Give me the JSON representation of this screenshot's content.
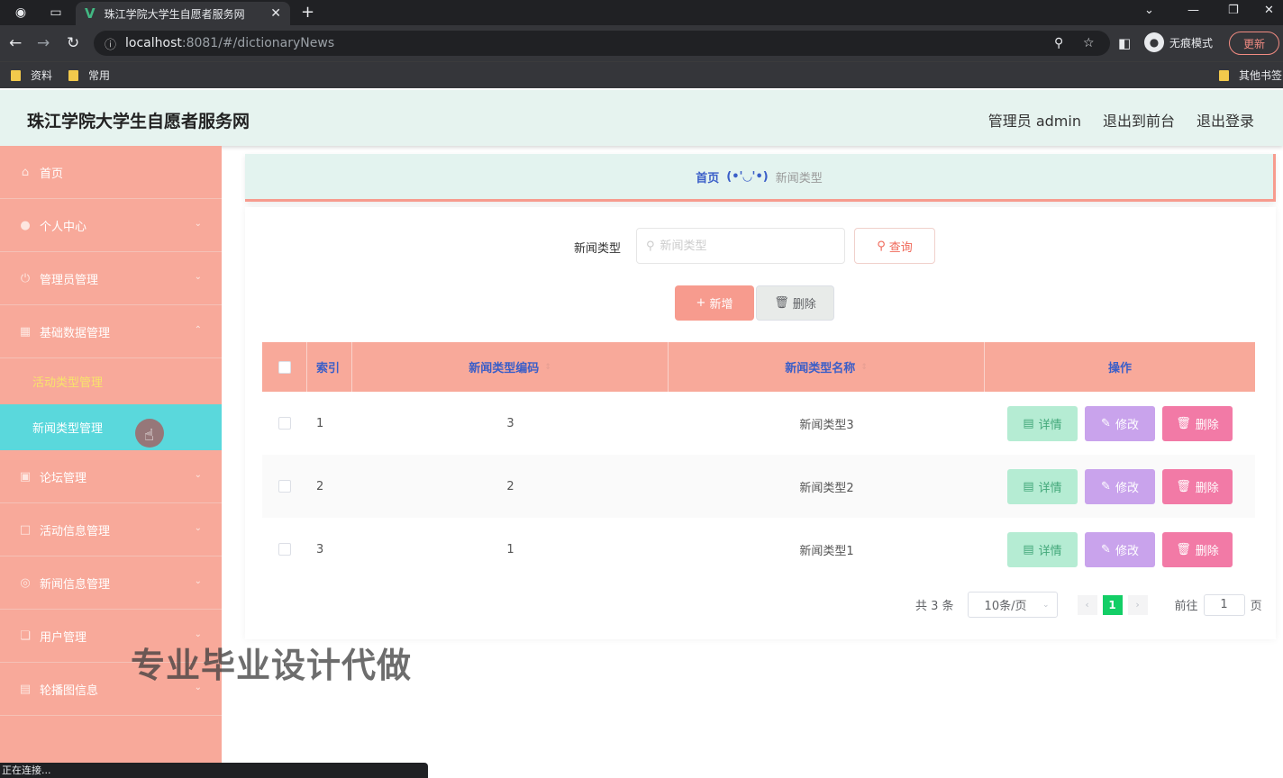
{
  "browser": {
    "tab_title": "珠江学院大学生自愿者服务网",
    "url_host": "localhost",
    "url_path": ":8081/#/dictionaryNews",
    "incognito_label": "无痕模式",
    "update_label": "更新",
    "bookmarks": [
      "资料",
      "常用"
    ],
    "other_bookmarks": "其他书签",
    "status_text": "正在连接..."
  },
  "header": {
    "title": "珠江学院大学生自愿者服务网",
    "user": "管理员 admin",
    "to_front": "退出到前台",
    "logout": "退出登录"
  },
  "sidebar": {
    "items": [
      {
        "label": "首页",
        "icon": "home-icon"
      },
      {
        "label": "个人中心",
        "icon": "user-icon"
      },
      {
        "label": "管理员管理",
        "icon": "power-icon"
      },
      {
        "label": "基础数据管理",
        "icon": "grid-icon",
        "expanded": true
      },
      {
        "label": "论坛管理",
        "icon": "chat-icon"
      },
      {
        "label": "活动信息管理",
        "icon": "message-icon"
      },
      {
        "label": "新闻信息管理",
        "icon": "globe-icon"
      },
      {
        "label": "用户管理",
        "icon": "copy-icon"
      },
      {
        "label": "轮播图信息",
        "icon": "picture-icon"
      }
    ],
    "subitems": [
      "活动类型管理",
      "新闻类型管理"
    ]
  },
  "breadcrumb": {
    "home": "首页",
    "sep": "(•'◡'•)",
    "current": "新闻类型"
  },
  "search": {
    "label": "新闻类型",
    "placeholder": "新闻类型",
    "button": "查询"
  },
  "actions": {
    "add": "新增",
    "delete": "删除"
  },
  "table": {
    "headers": [
      "索引",
      "新闻类型编码",
      "新闻类型名称",
      "操作"
    ],
    "rows": [
      {
        "index": "1",
        "code": "3",
        "name": "新闻类型3"
      },
      {
        "index": "2",
        "code": "2",
        "name": "新闻类型2"
      },
      {
        "index": "3",
        "code": "1",
        "name": "新闻类型1"
      }
    ],
    "row_actions": {
      "detail": "详情",
      "edit": "修改",
      "delete": "删除"
    }
  },
  "pagination": {
    "total": "共 3 条",
    "page_size": "10条/页",
    "current_page": "1",
    "goto_prefix": "前往",
    "goto_value": "1",
    "goto_suffix": "页"
  },
  "watermark": "专业毕业设计代做",
  "colors": {
    "sidebar": "#f8a99a",
    "active_menu": "#5ad8dc",
    "header_bg": "#e6f3ef",
    "table_header": "#f8a99a",
    "detail_btn": "#b5ecd3",
    "edit_btn": "#c9a3ec",
    "delete_btn": "#f27aa6",
    "pager_active": "#13ce66"
  }
}
